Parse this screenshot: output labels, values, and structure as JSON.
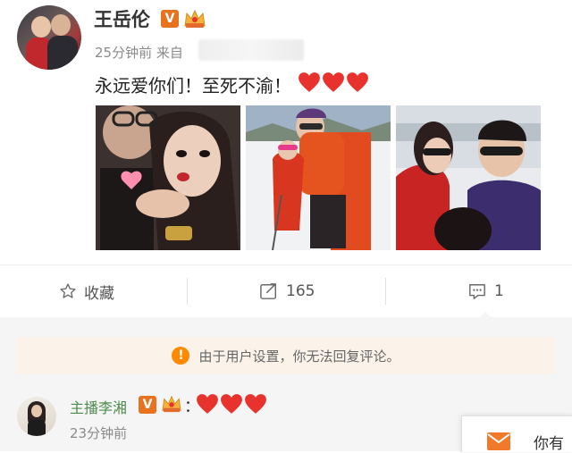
{
  "post": {
    "username": "王岳伦",
    "verified_badge": "V",
    "time_meta": "25分钟前 来自",
    "text": "永远爱你们！至死不渝！",
    "emoji_hearts": 3,
    "photos": [
      "photo-1",
      "photo-2",
      "photo-3"
    ]
  },
  "actions": {
    "favorite_label": "收藏",
    "repost_count": "165",
    "comment_count": "1"
  },
  "comments": {
    "notice": "由于用户设置，你无法回复评论。",
    "notice_icon": "!",
    "items": [
      {
        "username": "主播李湘",
        "verified_badge": "V",
        "colon": "：",
        "emoji_hearts": 3,
        "time": "23分钟前"
      }
    ]
  },
  "popup": {
    "text": "你有"
  },
  "colors": {
    "heart": "#e8322d",
    "badge_orange": "#e8731e",
    "comment_name_green": "#4b8a4b",
    "notice_bg": "#fbf3e9",
    "notice_icon": "#ff8a00",
    "mail_icon": "#f07a2a"
  },
  "icons": [
    "star-icon",
    "repost-icon",
    "comment-icon",
    "warning-icon",
    "mail-icon",
    "crown-badge-icon",
    "heart-icon"
  ]
}
